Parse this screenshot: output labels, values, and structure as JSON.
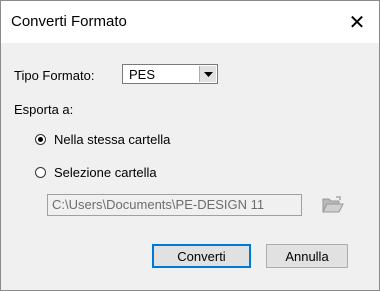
{
  "window": {
    "title": "Converti Formato",
    "close_glyph": "✕"
  },
  "format": {
    "label": "Tipo Formato:",
    "selected": "PES"
  },
  "export": {
    "label": "Esporta a:",
    "options": [
      {
        "label": "Nella stessa cartella",
        "checked": true
      },
      {
        "label": "Selezione cartella",
        "checked": false
      }
    ],
    "path": "C:\\Users\\Documents\\PE-DESIGN 11",
    "path_enabled": false
  },
  "buttons": {
    "convert": "Converti",
    "cancel": "Annulla"
  },
  "icons": {
    "close": "close-icon",
    "dropdown": "chevron-down-icon",
    "browse": "folder-open-icon"
  },
  "colors": {
    "dialog_bg": "#f0f0f0",
    "titlebar_bg": "#ffffff",
    "default_button_border": "#0078d7",
    "disabled_text": "#6d6d6d"
  }
}
